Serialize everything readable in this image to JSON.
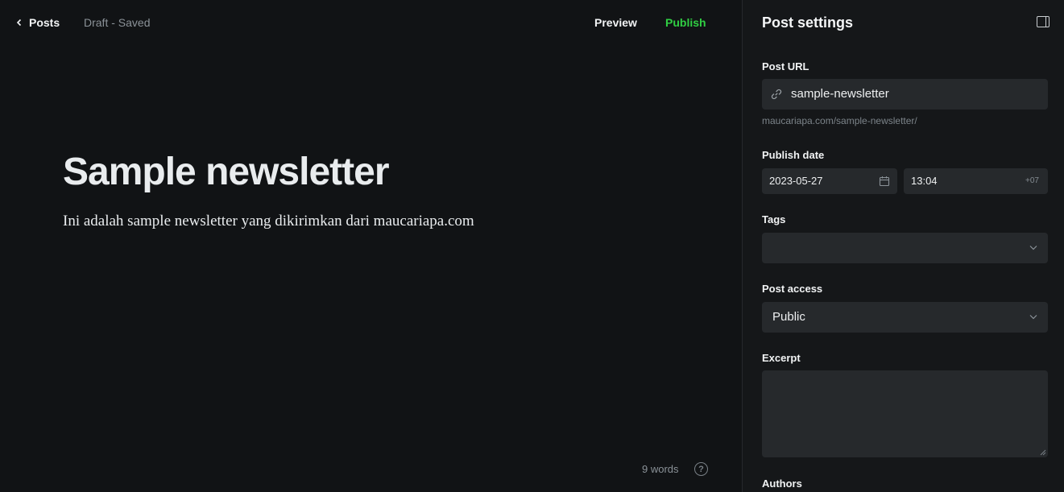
{
  "topbar": {
    "back_label": "Posts",
    "status": "Draft - Saved",
    "preview_label": "Preview",
    "publish_label": "Publish"
  },
  "editor": {
    "title": "Sample newsletter",
    "body": "Ini adalah sample newsletter yang dikirimkan dari maucariapa.com",
    "word_count": "9 words",
    "help_symbol": "?"
  },
  "settings": {
    "title": "Post settings",
    "post_url_label": "Post URL",
    "post_url_value": "sample-newsletter",
    "post_url_hint": "maucariapa.com/sample-newsletter/",
    "publish_date_label": "Publish date",
    "date_value": "2023-05-27",
    "time_value": "13:04",
    "timezone": "+07",
    "tags_label": "Tags",
    "post_access_label": "Post access",
    "post_access_value": "Public",
    "excerpt_label": "Excerpt",
    "authors_label": "Authors"
  },
  "colors": {
    "editor_bg": "#111315",
    "panel_bg": "#151719",
    "field_bg": "#26292c",
    "publish_green": "#30cf43"
  }
}
